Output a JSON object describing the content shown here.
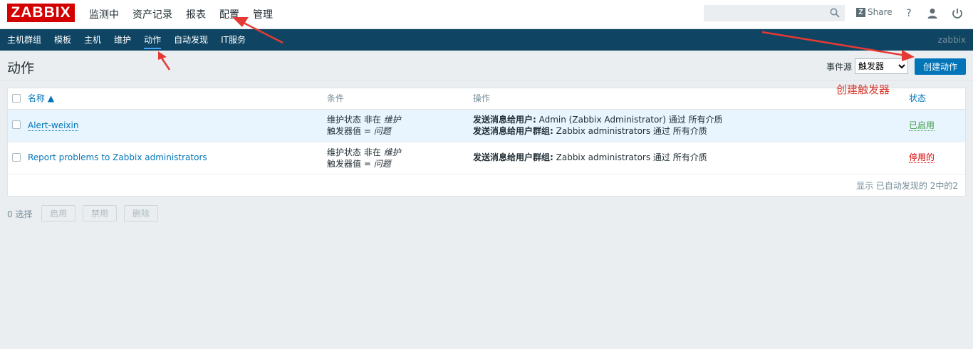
{
  "app": {
    "logo": "ZABBIX"
  },
  "main_nav": [
    "监测中",
    "资产记录",
    "报表",
    "配置",
    "管理"
  ],
  "header_tools": {
    "search_placeholder": "",
    "share_label": "Share",
    "help_label": "?"
  },
  "sub_nav": {
    "items": [
      "主机群组",
      "模板",
      "主机",
      "维护",
      "动作",
      "自动发现",
      "IT服务"
    ],
    "active": "动作",
    "user": "zabbix"
  },
  "page": {
    "title": "动作",
    "filter_label": "事件源",
    "filter_value": "触发器",
    "create_button": "创建动作"
  },
  "table": {
    "headers": {
      "name": "名称 ▲",
      "conditions": "条件",
      "operations": "操作",
      "status": "状态"
    },
    "rows": [
      {
        "name": "Alert-weixin",
        "cond1_prefix": "维护状态 非在 ",
        "cond1_value": "维护",
        "cond2_prefix": "触发器值 = ",
        "cond2_value": "问题",
        "op1_label": "发送消息给用户:",
        "op1_text": " Admin (Zabbix Administrator) 通过 所有介质",
        "op2_label": "发送消息给用户群组:",
        "op2_text": " Zabbix administrators 通过 所有介质",
        "status": "已启用"
      },
      {
        "name": "Report problems to Zabbix administrators",
        "cond1_prefix": "维护状态 非在 ",
        "cond1_value": "维护",
        "cond2_prefix": "触发器值 = ",
        "cond2_value": "问题",
        "op1_label": "发送消息给用户群组:",
        "op1_text": " Zabbix administrators 通过 所有介质",
        "status": "停用的"
      }
    ],
    "summary": "显示 已自动发现的 2中的2"
  },
  "actions": {
    "selected": "0 选择",
    "enable": "启用",
    "disable": "禁用",
    "delete": "删除"
  },
  "annotation": {
    "text": "创建触发器",
    "color": "#d93a2f"
  }
}
